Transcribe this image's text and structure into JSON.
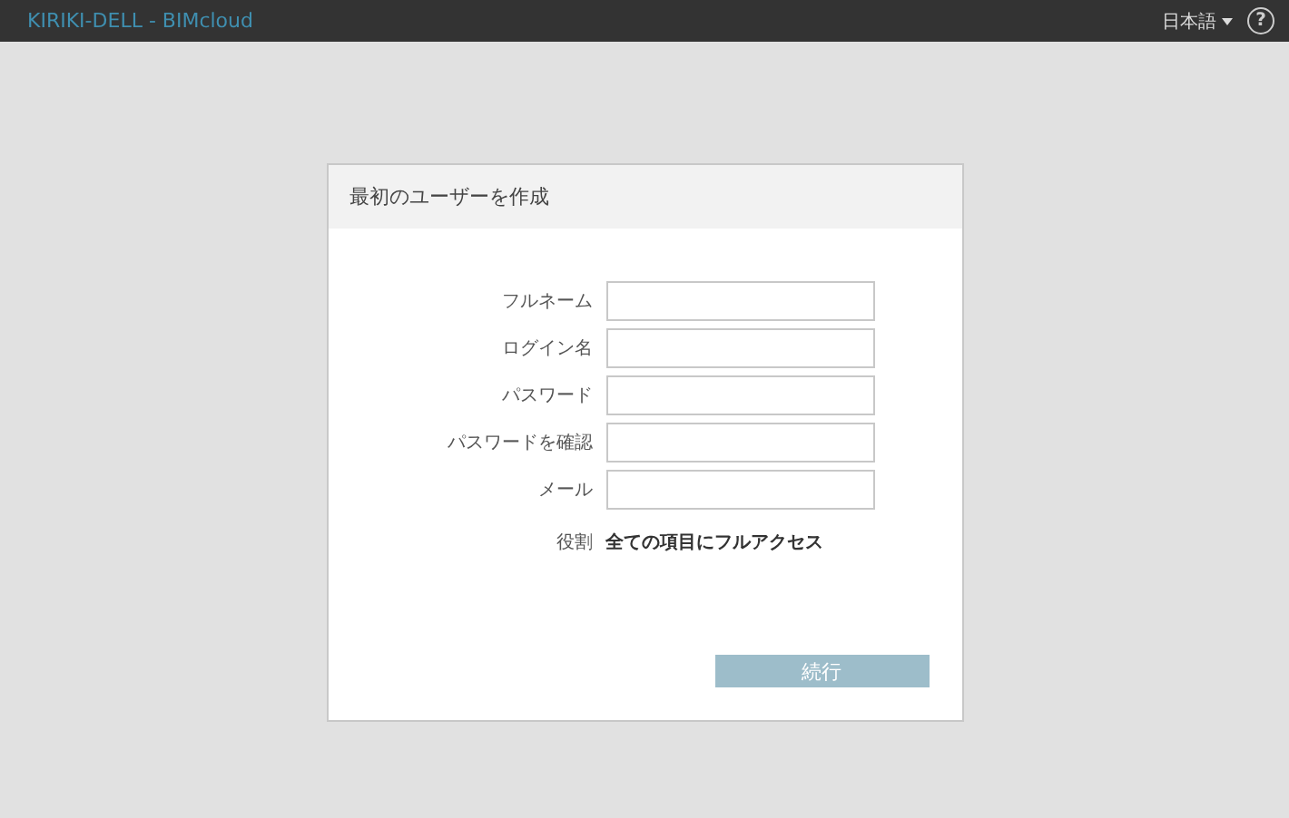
{
  "top_bar": {
    "title": "KIRIKI-DELL - BIMcloud",
    "language": "日本語",
    "help": "?"
  },
  "dialog": {
    "title": "最初のユーザーを作成",
    "fields": [
      {
        "label": "フルネーム"
      },
      {
        "label": "ログイン名"
      },
      {
        "label": "パスワード"
      },
      {
        "label": "パスワードを確認"
      },
      {
        "label": "メール"
      }
    ],
    "role": {
      "label": "役割",
      "value": "全ての項目にフルアクセス"
    },
    "button": {
      "label": "続行",
      "disabled": true
    }
  }
}
